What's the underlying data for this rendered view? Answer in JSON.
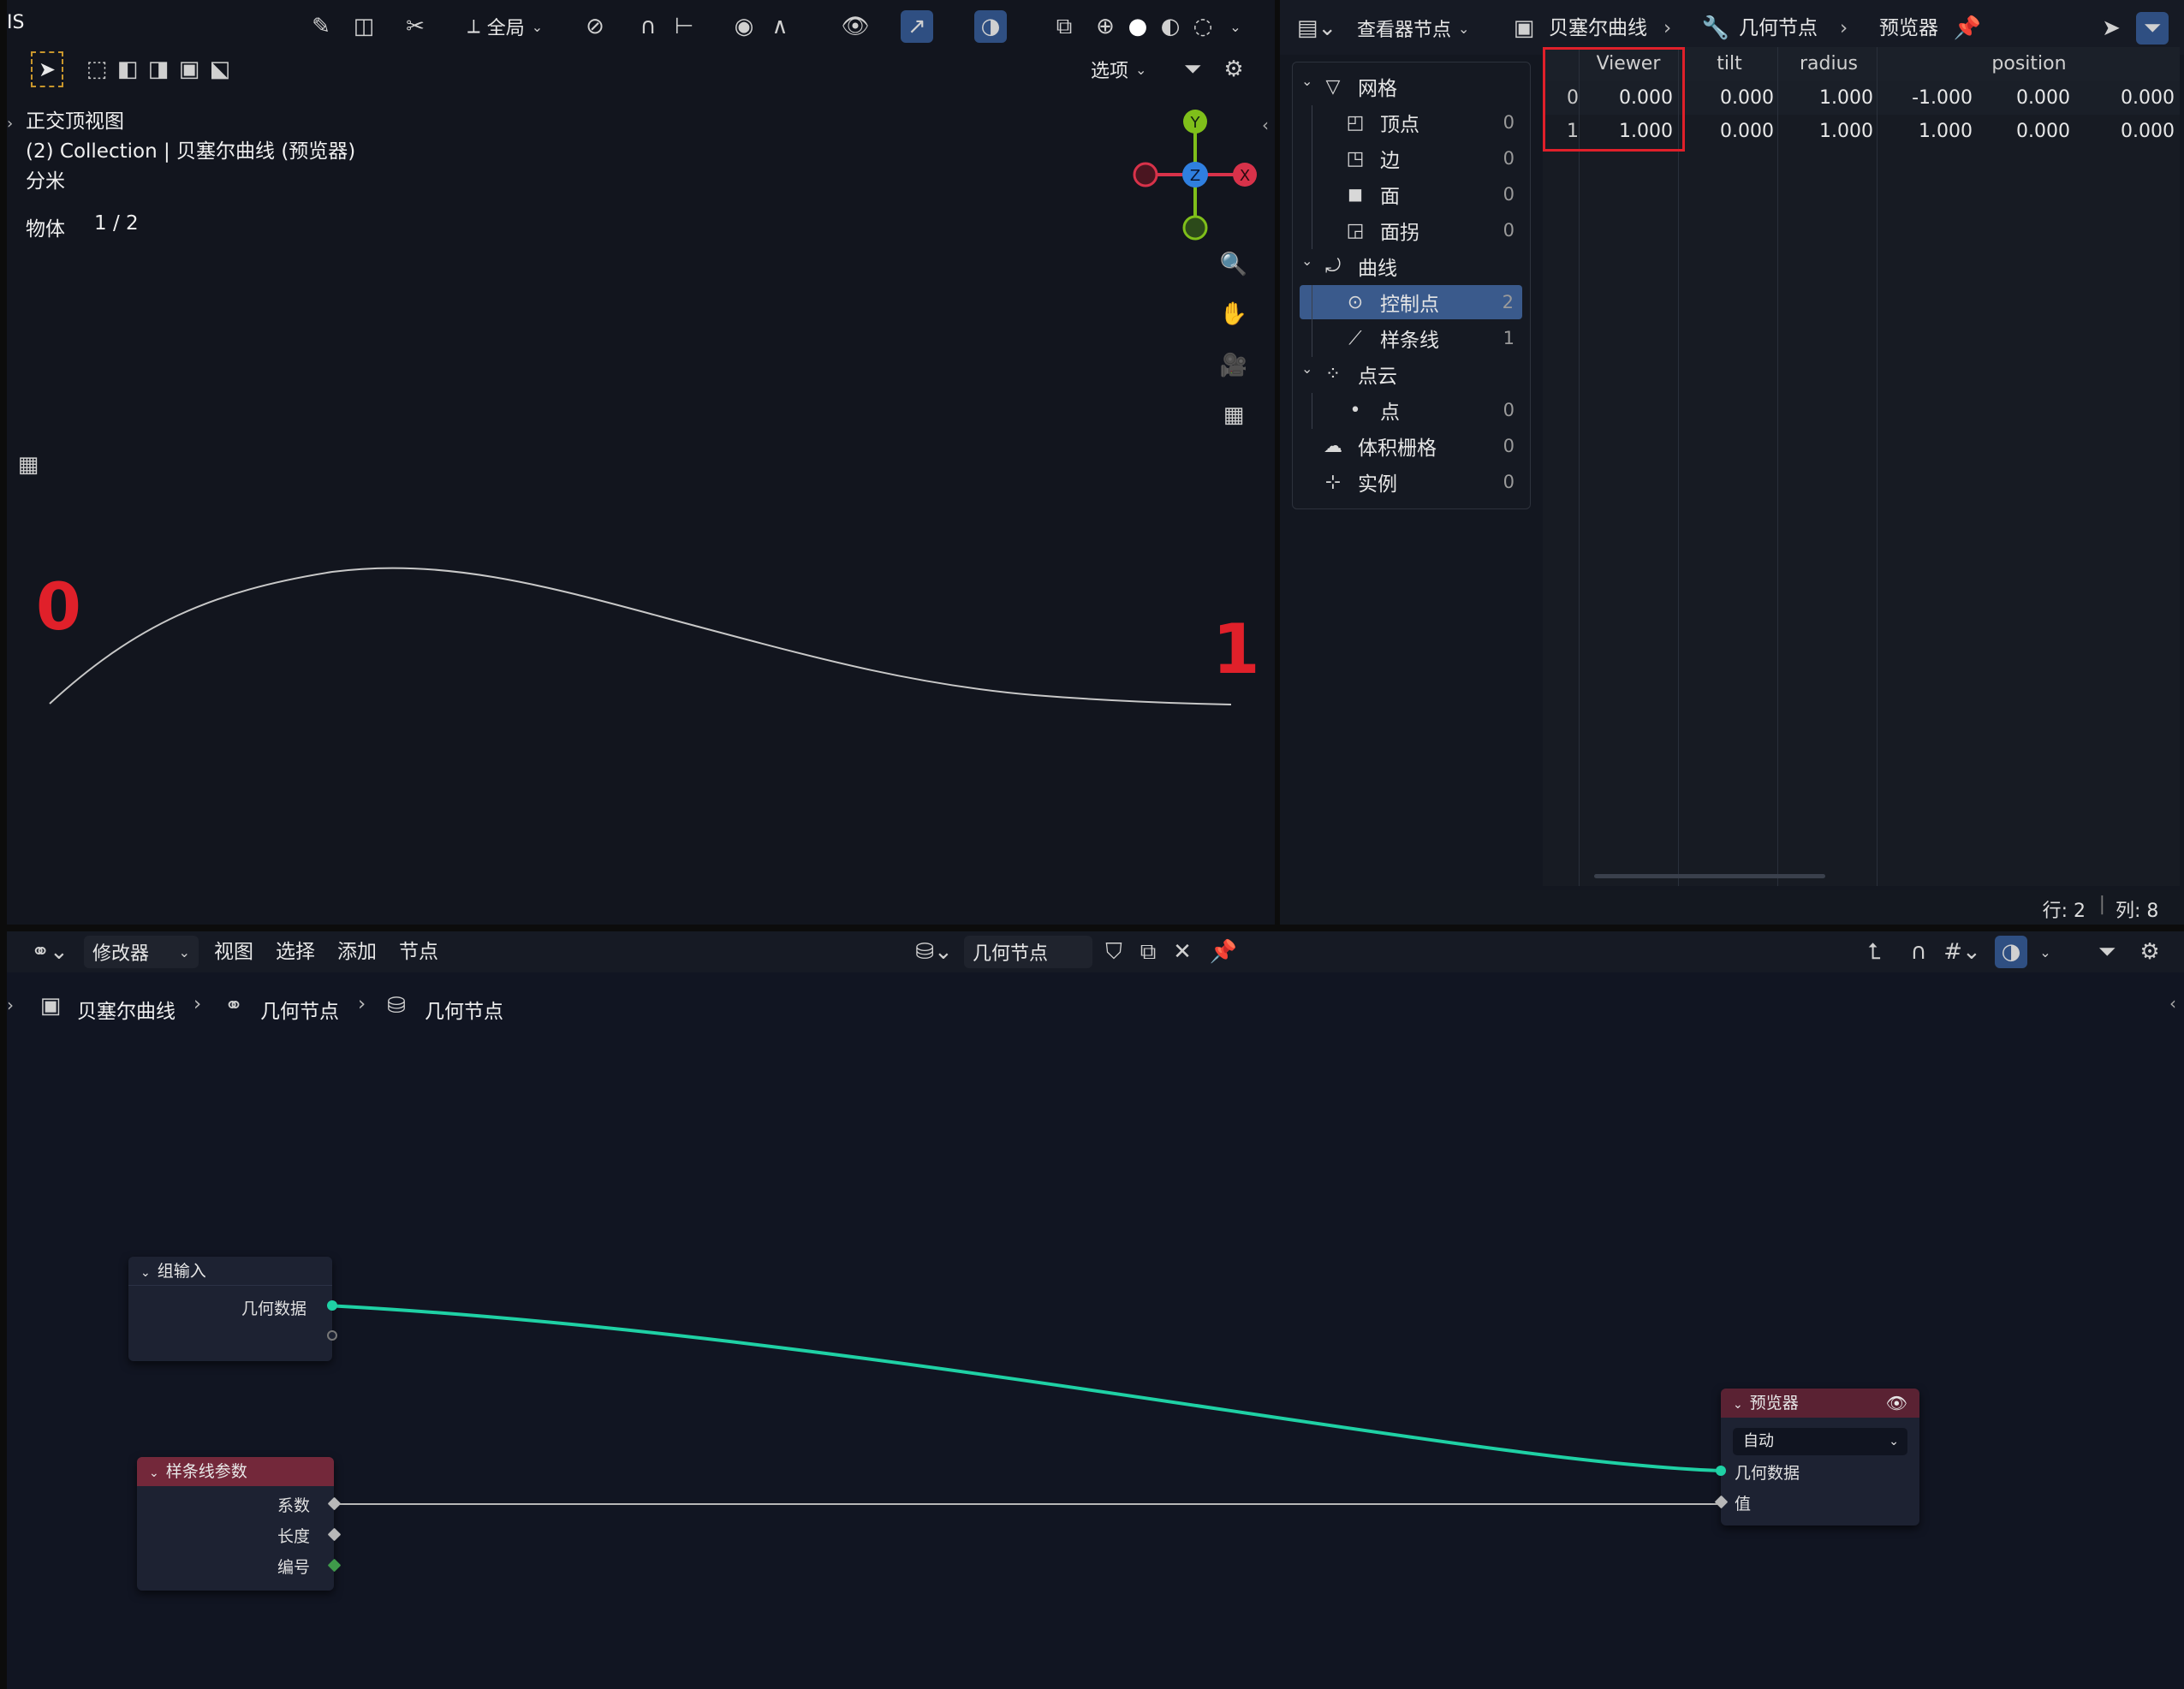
{
  "viewport": {
    "top_left_label": "IS",
    "view_name": "正交顶视图",
    "collection": "(2) Collection | 贝塞尔曲线 (预览器)",
    "units": "分米",
    "stat_label": "物体",
    "stat_value": "1 / 2",
    "global_label": "全局",
    "options_label": "选项",
    "marker_start": "0",
    "marker_end": "1",
    "gizmo": {
      "y": "Y",
      "z": "Z",
      "x": "X"
    }
  },
  "spreadsheet": {
    "editor_dropdown": "查看器节点",
    "breadcrumb": [
      "贝塞尔曲线",
      "几何节点",
      "预览器"
    ],
    "tree": [
      {
        "label": "网格",
        "count": "",
        "level": 0,
        "icon": "mesh-icon"
      },
      {
        "label": "顶点",
        "count": "0",
        "level": 1,
        "icon": "vertex-icon"
      },
      {
        "label": "边",
        "count": "0",
        "level": 1,
        "icon": "edge-icon"
      },
      {
        "label": "面",
        "count": "0",
        "level": 1,
        "icon": "face-icon"
      },
      {
        "label": "面拐",
        "count": "0",
        "level": 1,
        "icon": "face-corner-icon"
      },
      {
        "label": "曲线",
        "count": "",
        "level": 0,
        "icon": "curve-icon"
      },
      {
        "label": "控制点",
        "count": "2",
        "level": 1,
        "icon": "control-point-icon",
        "selected": true
      },
      {
        "label": "样条线",
        "count": "1",
        "level": 1,
        "icon": "spline-icon"
      },
      {
        "label": "点云",
        "count": "",
        "level": 0,
        "icon": "point-cloud-icon"
      },
      {
        "label": "点",
        "count": "0",
        "level": 1,
        "icon": "point-icon"
      },
      {
        "label": "体积栅格",
        "count": "0",
        "level": 0,
        "icon": "volume-icon"
      },
      {
        "label": "实例",
        "count": "0",
        "level": 0,
        "icon": "instance-icon"
      }
    ],
    "columns": [
      "Viewer",
      "tilt",
      "radius",
      "position"
    ],
    "rows": [
      {
        "index": "0",
        "viewer": "0.000",
        "tilt": "0.000",
        "radius": "1.000",
        "px": "-1.000",
        "py": "0.000",
        "pz": "0.000"
      },
      {
        "index": "1",
        "viewer": "1.000",
        "tilt": "0.000",
        "radius": "1.000",
        "px": "1.000",
        "py": "0.000",
        "pz": "0.000"
      }
    ],
    "footer_rows": "行: 2",
    "footer_cols": "列: 8",
    "highlight_color": "#e0202a"
  },
  "node_editor": {
    "editor_dropdown": "修改器",
    "menus": [
      "视图",
      "选择",
      "添加",
      "节点"
    ],
    "tree_name": "几何节点",
    "breadcrumb": [
      "贝塞尔曲线",
      "几何节点",
      "几何节点"
    ],
    "nodes": {
      "group_input": {
        "title": "组输入",
        "socket_geometry": "几何数据"
      },
      "spline_param": {
        "title": "样条线参数",
        "socket_factor": "系数",
        "socket_length": "长度",
        "socket_index": "编号"
      },
      "viewer": {
        "title": "预览器",
        "domain_value": "自动",
        "socket_geometry": "几何数据",
        "socket_value": "值"
      }
    },
    "colors": {
      "geometry_link": "#1fd1a5",
      "float_link": "#b8b8b8",
      "spline_header": "#73283a",
      "viewer_header": "#5a2233",
      "group_header": "#1d2232"
    }
  }
}
